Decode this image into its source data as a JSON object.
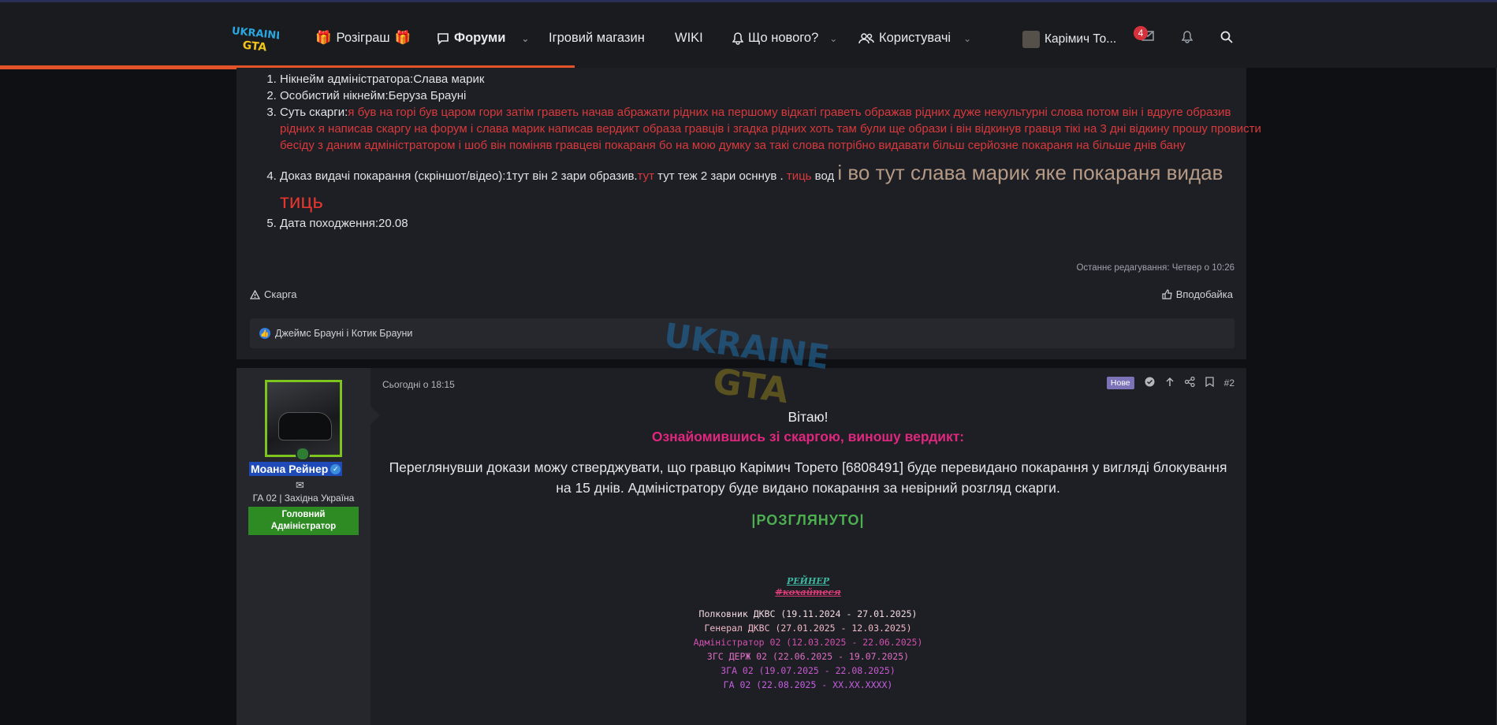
{
  "nav": {
    "giveaway_label": "Розіграш",
    "forums_label": "Форуми",
    "shop_label": "Ігровий магазин",
    "wiki_label": "WIKI",
    "whats_new_label": "Що нового?",
    "users_label": "Користувачі",
    "account_name": "Карімич То...",
    "inbox_count": "4"
  },
  "post1": {
    "items": [
      {
        "label": "Нікнейм адміністратора:",
        "value": "Слава марик"
      },
      {
        "label": "Особистий нікнейм:",
        "value": "Беруза Брауні"
      },
      {
        "label": "Суть скарги:",
        "value": "я був на горі був царом гори затім граветь начав абражати рідних на першому відкаті граветь ображав рідних дуже некультурні слова потом він і вдруге образив рідних я написав скаргу на форум і слава марик написав вердикт образа гравців і згадка рідних хоть там були ще образи і він відкинув гравця тікі на 3 дні відкину прошу провисти бесіду з даним адміністратором і шоб він поміняв гравцеві покараня бо на мою думку за такі слова потрібно видавати більш серйозне покараня на більше днів бану"
      },
      {
        "label": "Доказ видачі покарання (скріншот/відео):",
        "part1": "1тут він 2 зари образив.",
        "link1": "тут",
        "part2": " тут теж 2 зари осннув . ",
        "link2": "тиць",
        "part3": " вод ",
        "big": "і во тут слава марик яке покараня видав ",
        "link3": "тиць"
      },
      {
        "label": "Дата походження:",
        "value": "20.08"
      }
    ],
    "edited": "Останнє редагування: Четвер о 10:26",
    "report_label": "Скарга",
    "like_label": "Вподобайка",
    "reactions_text": "Джеймс Брауні і Котик Брауни"
  },
  "post2": {
    "author": "Моана Рейнер",
    "author_title": "ГА 02 | Західна Україна",
    "role_banner": "Головний Адміністратор",
    "date": "Сьогодні о 18:15",
    "new_badge": "Нове",
    "post_number": "#2",
    "greeting": "Вітаю!",
    "verdict_head": "Ознайомившись зі скаргою, виношу вердикт:",
    "verdict_text": "Переглянувши докази можу стверджувати, що гравцю Карімич Торето [6808491] буде перевидано покарання у вигляді блокування на 15 днів. Адміністратору буде видано покарання за невірний розгляд скарги.",
    "status": "|РОЗГЛЯНУТО|",
    "signature_name": "РЕЙНЕР",
    "signature_tag": "#кохайтеся",
    "history": [
      "Полковник ДКВС (19.11.2024 - 27.01.2025)",
      "Генерал ДКВС (27.01.2025 - 12.03.2025)",
      "Адміністратор 02 (12.03.2025 - 22.06.2025)",
      "ЗГС ДЕРЖ 02 (22.06.2025 - 19.07.2025)",
      "ЗГА 02 (19.07.2025 - 22.08.2025)",
      "ГА 02 (22.08.2025 - XX.XX.XXXX)"
    ]
  },
  "icons": [
    "gift-icon",
    "chat-icon",
    "bell-icon",
    "users-icon",
    "mail-icon",
    "search-icon",
    "warning-icon",
    "thumbs-up-icon",
    "share-icon",
    "bookmark-icon",
    "arrow-up-icon",
    "check-icon"
  ],
  "colors": {
    "accent_progress": "#e2532a",
    "red_text": "#d8393c",
    "verdict_pink": "#e0277f",
    "status_green": "#4caf50",
    "role_green": "#2e8b23",
    "username_bg": "#1f4bb8"
  }
}
